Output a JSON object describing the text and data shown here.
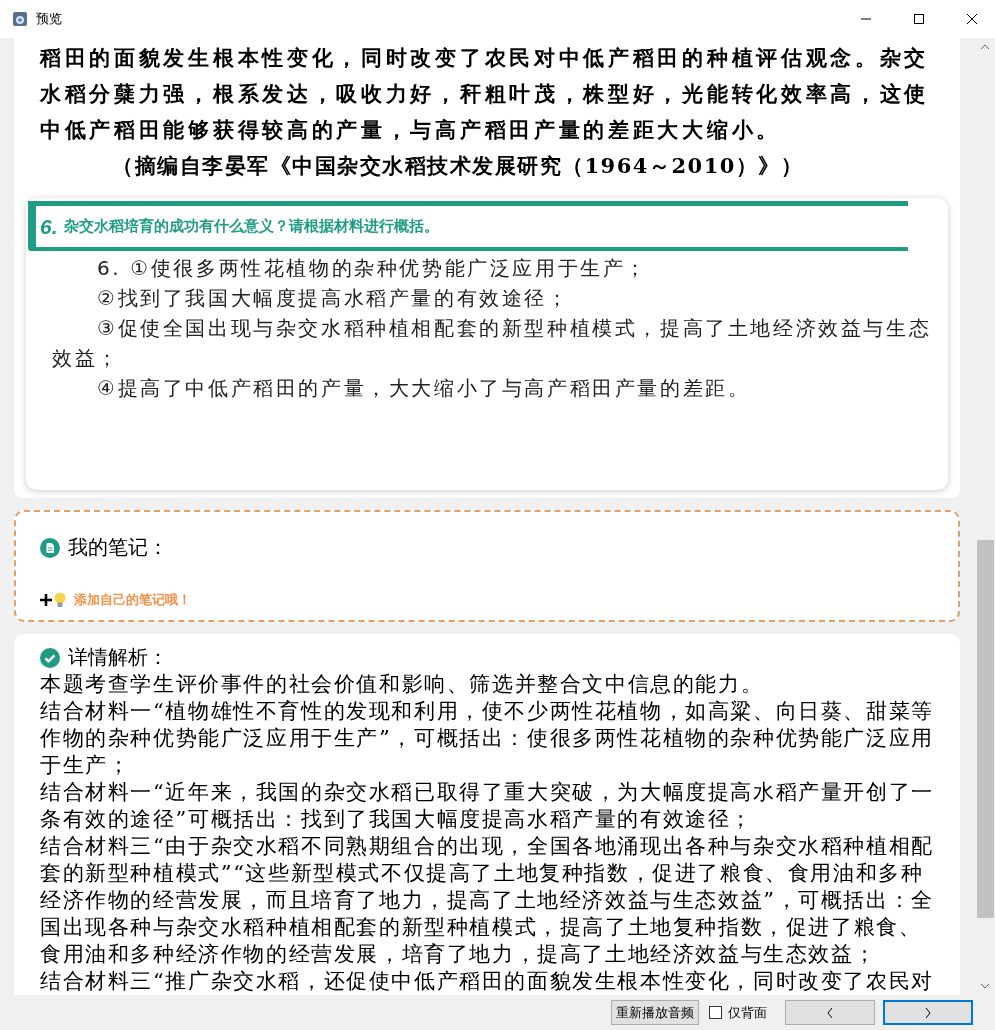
{
  "window": {
    "title": "预览"
  },
  "passage": {
    "text": "稻田的面貌发生根本性变化，同时改变了农民对中低产稻田的种植评估观念。杂交水稻分蘖力强，根系发达，吸收力好，秆粗叶茂，株型好，光能转化效率高，这使中低产稻田能够获得较高的产量，与高产稻田产量的差距大大缩小。",
    "source": "（摘编自李晏军《中国杂交水稻技术发展研究（1964～2010）》）"
  },
  "question": {
    "number": "6.",
    "prompt": "杂交水稻培育的成功有什么意义？请根据材料进行概括。"
  },
  "answer": [
    "6. ①使很多两性花植物的杂种优势能广泛应用于生产；",
    "②找到了我国大幅度提高水稻产量的有效途径；",
    "③促使全国出现与杂交水稻种植相配套的新型种植模式，提高了土地经济效益与生态效益；",
    "④提高了中低产稻田的产量，大大缩小了与高产稻田产量的差距。"
  ],
  "notes": {
    "title": "我的笔记：",
    "add_hint": "添加自己的笔记哦！"
  },
  "analysis": {
    "title": "详情解析：",
    "paragraphs": [
      "本题考查学生评价事件的社会价值和影响、筛选并整合文中信息的能力。",
      "结合材料一“植物雄性不育性的发现和利用，使不少两性花植物，如高粱、向日葵、甜菜等作物的杂种优势能广泛应用于生产”，可概括出：使很多两性花植物的杂种优势能广泛应用于生产；",
      "结合材料一“近年来，我国的杂交水稻已取得了重大突破，为大幅度提高水稻产量开创了一条有效的途径”可概括出：找到了我国大幅度提高水稻产量的有效途径；",
      "结合材料三“由于杂交水稻不同熟期组合的出现，全国各地涌现出各种与杂交水稻种植相配套的新型种植模式”“这些新型模式不仅提高了土地复种指数，促进了粮食、食用油和多种经济作物的经营发展，而且培育了地力，提高了土地经济效益与生态效益”，可概括出：全国出现各种与杂交水稻种植相配套的新型种植模式，提高了土地复种指数，促进了粮食、食用油和多种经济作物的经营发展，培育了地力，提高了土地经济效益与生态效益；",
      "结合材料三“推广杂交水稻，还促使中低产稻田的面貌发生根本性变化，同时改变了农民对"
    ]
  },
  "footer": {
    "replay_button": "重新播放音频",
    "back_only": {
      "label": "仅背面",
      "checked": false
    }
  }
}
